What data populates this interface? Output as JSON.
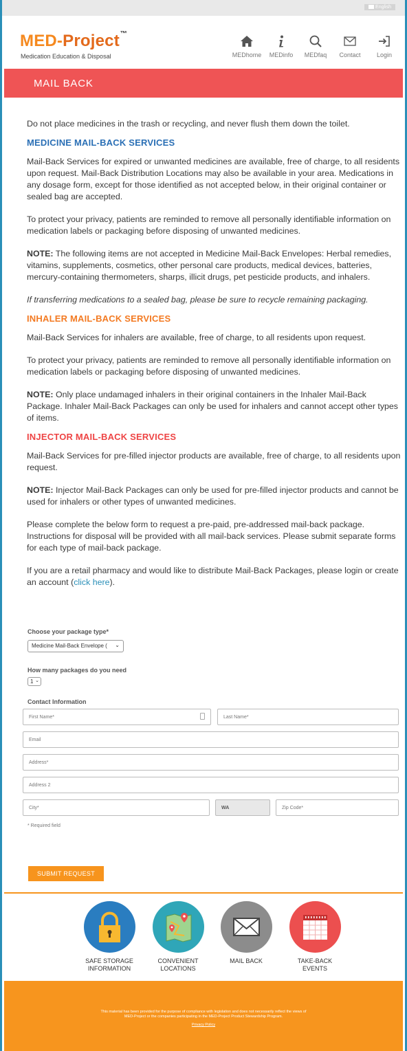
{
  "topbar": {
    "language": "English"
  },
  "logo": {
    "name_a": "MED-",
    "name_b": "Project",
    "tm": "™",
    "tagline": "Medication Education & Disposal"
  },
  "nav": [
    {
      "label": "MEDhome",
      "icon": "home-icon"
    },
    {
      "label": "MEDinfo",
      "icon": "info-icon"
    },
    {
      "label": "MEDfaq",
      "icon": "search-icon"
    },
    {
      "label": "Contact",
      "icon": "envelope-icon"
    },
    {
      "label": "Login",
      "icon": "login-icon"
    }
  ],
  "banner": {
    "title": "MAIL BACK"
  },
  "content": {
    "intro": "Do not place medicines in the trash or recycling, and never flush them down the toilet.",
    "medicine": {
      "heading": "MEDICINE MAIL-BACK SERVICES",
      "p1": "Mail-Back Services for expired or unwanted medicines are available, free of charge, to all residents upon request. Mail-Back Distribution Locations may also be available in your area. Medications in any dosage form, except for those identified as not accepted below, in their original container or sealed bag are accepted.",
      "p2": "To protect your privacy, patients are reminded to remove all personally identifiable information on medication labels or packaging before disposing of unwanted medicines.",
      "note_label": "NOTE:",
      "note": " The following items are not accepted in Medicine Mail-Back Envelopes: Herbal remedies, vitamins, supplements, cosmetics, other personal care products, medical devices, batteries, mercury-containing thermometers, sharps, illicit drugs, pet pesticide products, and inhalers.",
      "italic": "If transferring medications to a sealed bag, please be sure to recycle remaining packaging."
    },
    "inhaler": {
      "heading": "INHALER MAIL-BACK SERVICES",
      "p1": "Mail-Back Services for inhalers are available, free of charge, to all residents upon request.",
      "p2": "To protect your privacy, patients are reminded to remove all personally identifiable information on medication labels or packaging before disposing of unwanted medicines.",
      "note_label": "NOTE:",
      "note": " Only place undamaged inhalers in their original containers in the Inhaler Mail-Back Package. Inhaler Mail-Back Packages can only be used for inhalers and cannot accept other types of items."
    },
    "injector": {
      "heading": "INJECTOR MAIL-BACK SERVICES",
      "p1": "Mail-Back Services for pre-filled injector products are available, free of charge, to all residents upon request.",
      "note_label": "NOTE:",
      "note": " Injector Mail-Back Packages can only be used for pre-filled injector products and cannot be used for inhalers or other types of unwanted medicines.",
      "p2": "Please complete the below form to request a pre-paid, pre-addressed mail-back package. Instructions for disposal will be provided with all mail-back services. Please submit separate forms for each type of mail-back package.",
      "p3_a": "If you are a retail pharmacy and would like to distribute Mail-Back Packages, please login or create an account (",
      "p3_link": "click here",
      "p3_b": ")."
    }
  },
  "form": {
    "package_label": "Choose your package type*",
    "package_value": "Medicine Mail-Back Envelope (",
    "qty_label": "How many packages do you need",
    "qty_value": "1",
    "contact_label": "Contact Information",
    "first_name": "First Name*",
    "last_name": "Last Name*",
    "email": "Email",
    "address": "Address*",
    "address2": "Address 2",
    "city": "City*",
    "state": "WA",
    "zip": "Zip Code*",
    "required_note": "* Required field",
    "submit": "SUBMIT REQUEST"
  },
  "features": [
    {
      "label_1": "SAFE STORAGE",
      "label_2": "INFORMATION",
      "icon": "lock-icon",
      "color": "#2a7dc0"
    },
    {
      "label_1": "CONVENIENT",
      "label_2": "LOCATIONS",
      "icon": "map-icon",
      "color": "#2fa6b8"
    },
    {
      "label_1": "MAIL BACK",
      "label_2": "",
      "icon": "mail-icon",
      "color": "#8c8c8c"
    },
    {
      "label_1": "TAKE-BACK",
      "label_2": "EVENTS",
      "icon": "calendar-icon",
      "color": "#ec4f4f"
    }
  ],
  "footer": {
    "text_1": "This material has been provided for the purpose of compliance with legislation and does not necessarily reflect the views of",
    "text_2": "MED-Project or the companies participating in the MED-Project Product Stewardship Program.",
    "privacy": "Privacy Policy"
  }
}
